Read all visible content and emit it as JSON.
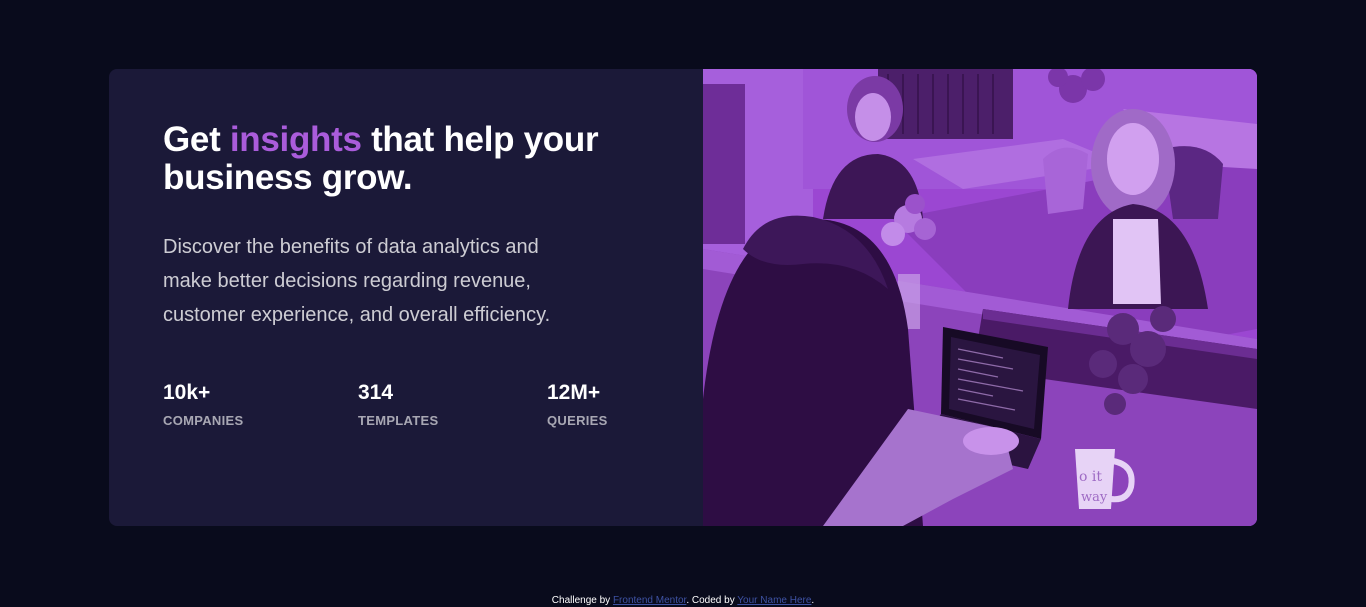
{
  "card": {
    "headline_start": "Get ",
    "headline_accent": "insights",
    "headline_end": " that help your business grow.",
    "description": "Discover the benefits of data analytics and make better decisions regarding revenue, customer experience, and overall efficiency.",
    "stats": [
      {
        "value": "10k+",
        "label": "COMPANIES"
      },
      {
        "value": "314",
        "label": "TEMPLATES"
      },
      {
        "value": "12M+",
        "label": "QUERIES"
      }
    ],
    "image": {
      "mug_text_line1": "o it",
      "mug_text_line2": "way"
    }
  },
  "footer": {
    "prefix": "Challenge by ",
    "link1": "Frontend Mentor",
    "middle": ". Coded by ",
    "link2": "Your Name Here",
    "suffix": "."
  },
  "colors": {
    "page_background": "#090b1c",
    "card_background": "#1b1938",
    "accent": "#aa5cdb",
    "image_overlay": "#9a46d1"
  }
}
